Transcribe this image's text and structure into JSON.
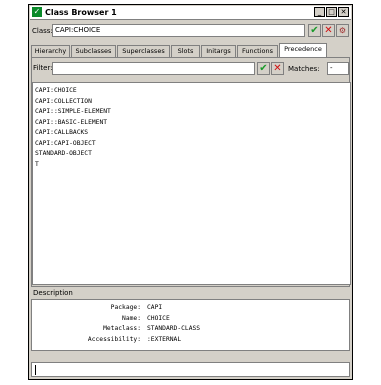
{
  "window": {
    "title": "Class Browser 1",
    "min_glyph": "_",
    "max_glyph": "□",
    "close_glyph": "✕"
  },
  "class_row": {
    "label": "Class:",
    "value": "CAPI:CHOICE",
    "ok_glyph": "✔",
    "cancel_glyph": "✕",
    "extra_icon_glyph": "⚙"
  },
  "tabs": [
    {
      "label": "Hierarchy"
    },
    {
      "label": "Subclasses"
    },
    {
      "label": "Superclasses"
    },
    {
      "label": "Slots"
    },
    {
      "label": "Initargs"
    },
    {
      "label": "Functions"
    },
    {
      "label": "Precedence"
    }
  ],
  "filter": {
    "label": "Filter:",
    "value": "",
    "ok_glyph": "✔",
    "cancel_glyph": "✕",
    "matches_label": "Matches:",
    "matches_value": "-"
  },
  "precedence_list": [
    "CAPI:CHOICE",
    "CAPI:COLLECTION",
    "CAPI::SIMPLE-ELEMENT",
    "CAPI::BASIC-ELEMENT",
    "CAPI:CALLBACKS",
    "CAPI:CAPI-OBJECT",
    "STANDARD-OBJECT",
    "T"
  ],
  "description": {
    "label": "Description",
    "rows": [
      {
        "key": "Package:",
        "value": "CAPI"
      },
      {
        "key": "Name:",
        "value": "CHOICE"
      },
      {
        "key": "Metaclass:",
        "value": "STANDARD-CLASS"
      },
      {
        "key": "Accessibility:",
        "value": ":EXTERNAL"
      }
    ]
  },
  "colors": {
    "ok_green": "#1a9a2a",
    "cancel_red": "#d01010",
    "app_icon_green": "#0a8a2a"
  }
}
